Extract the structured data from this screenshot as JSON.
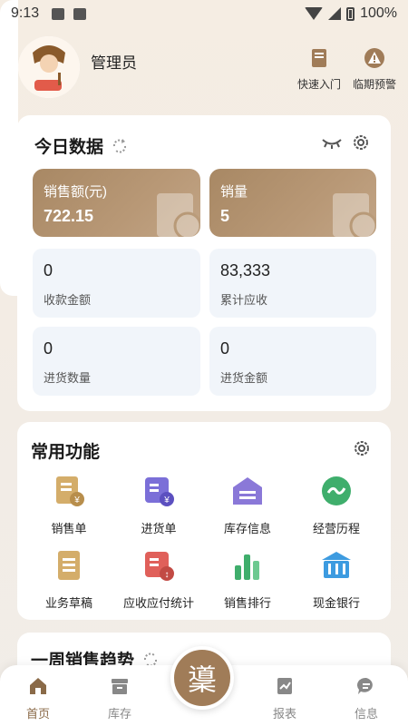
{
  "status_bar": {
    "time": "9:13",
    "battery": "100%"
  },
  "header": {
    "user_name": "管理员",
    "quick_entry": "快速入门",
    "expiry_warning": "临期预警"
  },
  "today": {
    "title": "今日数据",
    "sales_amount": {
      "label": "销售额(元)",
      "value": "722.15"
    },
    "sales_qty": {
      "label": "销量",
      "value": "5"
    },
    "received": {
      "label": "收款金额",
      "value": "0"
    },
    "receivable": {
      "label": "累计应收",
      "value": "83,333"
    },
    "purchase_qty": {
      "label": "进货数量",
      "value": "0"
    },
    "purchase_amount": {
      "label": "进货金额",
      "value": "0"
    }
  },
  "functions": {
    "title": "常用功能",
    "items": [
      {
        "label": "销售单",
        "icon": "sales-order-icon",
        "color": "#c9a25e"
      },
      {
        "label": "进货单",
        "icon": "purchase-order-icon",
        "color": "#7b6fd8"
      },
      {
        "label": "库存信息",
        "icon": "warehouse-icon",
        "color": "#8a78d8"
      },
      {
        "label": "经营历程",
        "icon": "history-icon",
        "color": "#3fae6c"
      },
      {
        "label": "业务草稿",
        "icon": "draft-icon",
        "color": "#c9a25e"
      },
      {
        "label": "应收应付统计",
        "icon": "receivable-payable-icon",
        "color": "#e0605a"
      },
      {
        "label": "销售排行",
        "icon": "ranking-icon",
        "color": "#3fae6c"
      },
      {
        "label": "现金银行",
        "icon": "bank-icon",
        "color": "#3d9be0"
      }
    ]
  },
  "trend": {
    "title": "一周销售趋势"
  },
  "nav": {
    "home": "首页",
    "inventory": "库存",
    "center": "䆃",
    "reports": "报表",
    "messages": "信息"
  },
  "colors": {
    "accent": "#a07c58",
    "card_hi": "#b08f6c"
  }
}
